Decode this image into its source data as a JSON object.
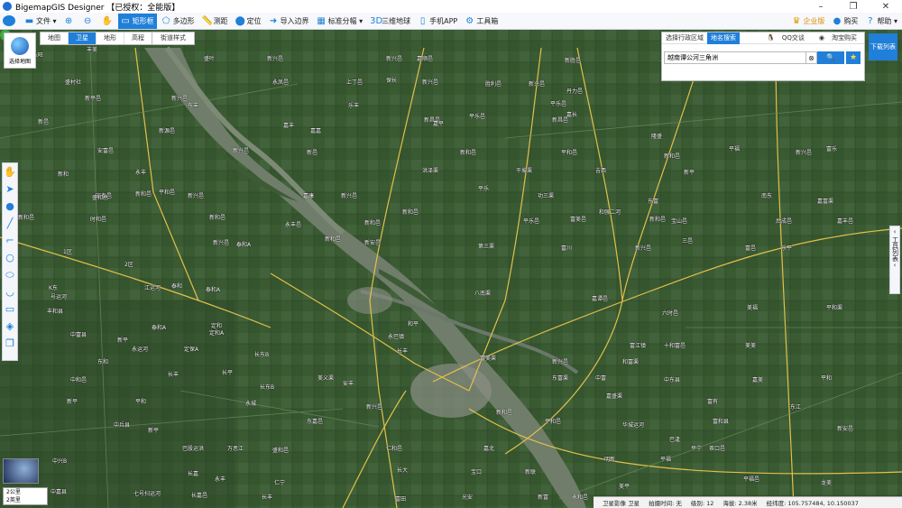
{
  "app": {
    "title": "BigemapGIS Designer 【已授权：全能版】"
  },
  "toolbar": {
    "items": [
      {
        "label": "文件 ▾",
        "icon": "folder-icon"
      },
      {
        "label": "",
        "icon": "zoom-in-icon"
      },
      {
        "label": "",
        "icon": "zoom-out-icon"
      },
      {
        "label": "",
        "icon": "hand-icon"
      },
      {
        "label": "矩形框",
        "icon": "rectangle-icon",
        "active": true
      },
      {
        "label": "多边形",
        "icon": "polygon-icon"
      },
      {
        "label": "测距",
        "icon": "ruler-icon"
      },
      {
        "label": "定位",
        "icon": "location-icon"
      },
      {
        "label": "导入边界",
        "icon": "import-icon"
      },
      {
        "label": "标准分幅 ▾",
        "icon": "grid-icon"
      },
      {
        "label": "三维地球",
        "icon": "3d-icon"
      },
      {
        "label": "手机APP",
        "icon": "phone-icon"
      },
      {
        "label": "工具箱",
        "icon": "gear-icon"
      }
    ],
    "right": [
      "企业版",
      "购买",
      "帮助 ▾"
    ]
  },
  "layer_tabs": [
    "地图",
    "卫星",
    "地形",
    "高程"
  ],
  "active_layer": "卫星",
  "street_style": "街道样式",
  "select_map": "选择地图",
  "search": {
    "tab_region": "选择行政区域",
    "tab_place": "地名搜索",
    "qq": "QQ交谈",
    "taobao": "淘宝购买",
    "value": "越南谭公河三角洲",
    "search_label": "🔍"
  },
  "download_list": "下载列表",
  "tool_list": "工具列表",
  "scale": {
    "line1": "2公里",
    "line2": "2英里"
  },
  "status": {
    "image": "卫星影像 卫星",
    "shot_time": "拍摄时间: 无",
    "level": "级别: 12",
    "altitude": "海拔: 2.38米",
    "coords": "经纬度: 105.757484, 10.150037"
  },
  "places": [
    [
      "永旺",
      36,
      56
    ],
    [
      "丰美",
      96,
      50
    ],
    [
      "盛叶",
      226,
      60
    ],
    [
      "新兴邑",
      296,
      60
    ],
    [
      "新兴邑",
      428,
      60
    ],
    [
      "嘉顺邑",
      462,
      60
    ],
    [
      "新胜邑",
      626,
      62
    ],
    [
      "龙州",
      732,
      60
    ],
    [
      "盛村社",
      72,
      86
    ],
    [
      "永凤邑",
      302,
      86
    ],
    [
      "上丁邑",
      384,
      86
    ],
    [
      "保长",
      428,
      84
    ],
    [
      "新兴邑",
      468,
      86
    ],
    [
      "胜利邑",
      538,
      88
    ],
    [
      "新兴邑",
      586,
      88
    ],
    [
      "丹力邑",
      628,
      96
    ],
    [
      "新平邑",
      94,
      104
    ],
    [
      "新兴邑",
      190,
      104
    ],
    [
      "东丰",
      208,
      112
    ],
    [
      "乐丰",
      386,
      112
    ],
    [
      "平乐邑",
      610,
      110
    ],
    [
      "嘉长",
      628,
      122
    ],
    [
      "新邑",
      42,
      130
    ],
    [
      "新源邑",
      176,
      140
    ],
    [
      "嘉丰",
      314,
      134
    ],
    [
      "嘉嘉",
      344,
      140
    ],
    [
      "新昌邑",
      470,
      128
    ],
    [
      "嘉平",
      480,
      132
    ],
    [
      "平乐邑",
      520,
      124
    ],
    [
      "新昌邑",
      612,
      128
    ],
    [
      "安富邑",
      108,
      162
    ],
    [
      "新兴邑",
      258,
      162
    ],
    [
      "新邑",
      340,
      164
    ],
    [
      "新和邑",
      510,
      164
    ],
    [
      "平和邑",
      622,
      164
    ],
    [
      "隆盛",
      722,
      146
    ],
    [
      "新和邑",
      736,
      168
    ],
    [
      "平福",
      808,
      160
    ],
    [
      "新兴邑",
      882,
      164
    ],
    [
      "富乐",
      916,
      160
    ],
    [
      "新和",
      64,
      188
    ],
    [
      "洪泽渠",
      468,
      184
    ],
    [
      "干坡渠",
      572,
      184
    ],
    [
      "吉西",
      660,
      184
    ],
    [
      "新平",
      758,
      186
    ],
    [
      "安泰邑",
      106,
      212
    ],
    [
      "新和邑",
      150,
      210
    ],
    [
      "平和邑",
      176,
      208
    ],
    [
      "新兴邑",
      208,
      212
    ],
    [
      "永丰",
      150,
      186
    ],
    [
      "嘉康",
      336,
      212
    ],
    [
      "新兴邑",
      378,
      212
    ],
    [
      "平乐",
      530,
      204
    ],
    [
      "功三渠",
      596,
      212
    ],
    [
      "东富",
      718,
      218
    ],
    [
      "南东",
      844,
      212
    ],
    [
      "嘉富渠",
      906,
      218
    ],
    [
      "盛和总",
      102,
      214
    ],
    [
      "新和邑",
      20,
      236
    ],
    [
      "时和邑",
      100,
      238
    ],
    [
      "新和邑",
      232,
      236
    ],
    [
      "永丰邑",
      316,
      244
    ],
    [
      "新和邑",
      404,
      242
    ],
    [
      "新和邑",
      446,
      230
    ],
    [
      "平乐邑",
      580,
      240
    ],
    [
      "富美邑",
      632,
      238
    ],
    [
      "和强二河",
      664,
      230
    ],
    [
      "新和邑",
      720,
      238
    ],
    [
      "宝山邑",
      744,
      240
    ],
    [
      "后成邑",
      860,
      240
    ],
    [
      "嘉丰邑",
      928,
      240
    ],
    [
      "1区",
      70,
      274
    ],
    [
      "2区",
      138,
      288
    ],
    [
      "新兴邑",
      236,
      264
    ],
    [
      "泰和A",
      262,
      266
    ],
    [
      "新和邑",
      360,
      260
    ],
    [
      "新安邑",
      404,
      264
    ],
    [
      "第三渠",
      530,
      268
    ],
    [
      "富川",
      622,
      270
    ],
    [
      "新兴邑",
      704,
      270
    ],
    [
      "三邑",
      756,
      262
    ],
    [
      "富邑",
      826,
      270
    ],
    [
      "乐平",
      866,
      270
    ],
    [
      "K东",
      54,
      314
    ],
    [
      "号运河",
      56,
      324
    ],
    [
      "江运河",
      160,
      314
    ],
    [
      "泰和",
      190,
      312
    ],
    [
      "泰和A",
      228,
      316
    ],
    [
      "八南渠",
      526,
      320
    ],
    [
      "嘉谭邑",
      656,
      326
    ],
    [
      "六时邑",
      734,
      342
    ],
    [
      "美福",
      828,
      336
    ],
    [
      "平和渠",
      916,
      336
    ],
    [
      "丰和县",
      52,
      340
    ],
    [
      "泰和A",
      168,
      358
    ],
    [
      "定和",
      234,
      356
    ],
    [
      "定和A",
      232,
      364
    ],
    [
      "永运河",
      146,
      382
    ],
    [
      "和平",
      452,
      354
    ],
    [
      "永巴镇",
      430,
      368
    ],
    [
      "富美渠",
      532,
      392
    ],
    [
      "富江镇",
      698,
      378
    ],
    [
      "美美",
      826,
      378
    ],
    [
      "中富县",
      78,
      366
    ],
    [
      "新平",
      130,
      372
    ],
    [
      "东和",
      108,
      396
    ],
    [
      "定保A",
      204,
      382
    ],
    [
      "长东B",
      282,
      388
    ],
    [
      "长丰",
      440,
      384
    ],
    [
      "新兴邑",
      612,
      396
    ],
    [
      "和富渠",
      690,
      396
    ],
    [
      "十和富邑",
      736,
      378
    ],
    [
      "中和邑",
      78,
      416
    ],
    [
      "长丰",
      186,
      410
    ],
    [
      "长平",
      246,
      408
    ],
    [
      "长东B",
      288,
      424
    ],
    [
      "美义渠",
      352,
      414
    ],
    [
      "安丰",
      380,
      420
    ],
    [
      "东富渠",
      612,
      414
    ],
    [
      "中富",
      660,
      414
    ],
    [
      "中东县",
      736,
      416
    ],
    [
      "嘉美",
      834,
      416
    ],
    [
      "平和",
      910,
      414
    ],
    [
      "新平",
      74,
      440
    ],
    [
      "平和",
      150,
      440
    ],
    [
      "永城",
      272,
      442
    ],
    [
      "新兴邑",
      406,
      446
    ],
    [
      "新和邑",
      550,
      452
    ],
    [
      "嘉盛渠",
      672,
      434
    ],
    [
      "富有",
      784,
      440
    ],
    [
      "东江",
      876,
      446
    ],
    [
      "中兵县",
      126,
      466
    ],
    [
      "新平",
      164,
      472
    ],
    [
      "东嘉邑",
      340,
      462
    ],
    [
      "平和邑",
      604,
      462
    ],
    [
      "华城运河",
      690,
      466
    ],
    [
      "富和县",
      790,
      462
    ],
    [
      "新安邑",
      928,
      470
    ],
    [
      "巴股运洪",
      202,
      492
    ],
    [
      "万恶江",
      252,
      492
    ],
    [
      "盛和邑",
      302,
      494
    ],
    [
      "仁和邑",
      428,
      492
    ],
    [
      "嘉北",
      536,
      492
    ],
    [
      "巴逢",
      742,
      482
    ],
    [
      "平宁",
      766,
      492
    ],
    [
      "茶口邑",
      786,
      492
    ],
    [
      "中兴B",
      58,
      506
    ],
    [
      "长嘉",
      208,
      520
    ],
    [
      "永丰",
      238,
      526
    ],
    [
      "仁宁",
      304,
      530
    ],
    [
      "长大",
      440,
      516
    ],
    [
      "宝口",
      522,
      518
    ],
    [
      "新联",
      582,
      518
    ],
    [
      "明新",
      670,
      504
    ],
    [
      "平福",
      732,
      504
    ],
    [
      "平福邑",
      824,
      526
    ],
    [
      "中嘉县",
      56,
      540
    ],
    [
      "七号扫运河",
      148,
      542
    ],
    [
      "长嘉邑",
      212,
      544
    ],
    [
      "长丰",
      290,
      546
    ],
    [
      "富田",
      438,
      548
    ],
    [
      "光安",
      512,
      546
    ],
    [
      "新富",
      596,
      546
    ],
    [
      "永和邑",
      634,
      546
    ],
    [
      "美平",
      686,
      534
    ],
    [
      "龙美",
      910,
      530
    ]
  ]
}
